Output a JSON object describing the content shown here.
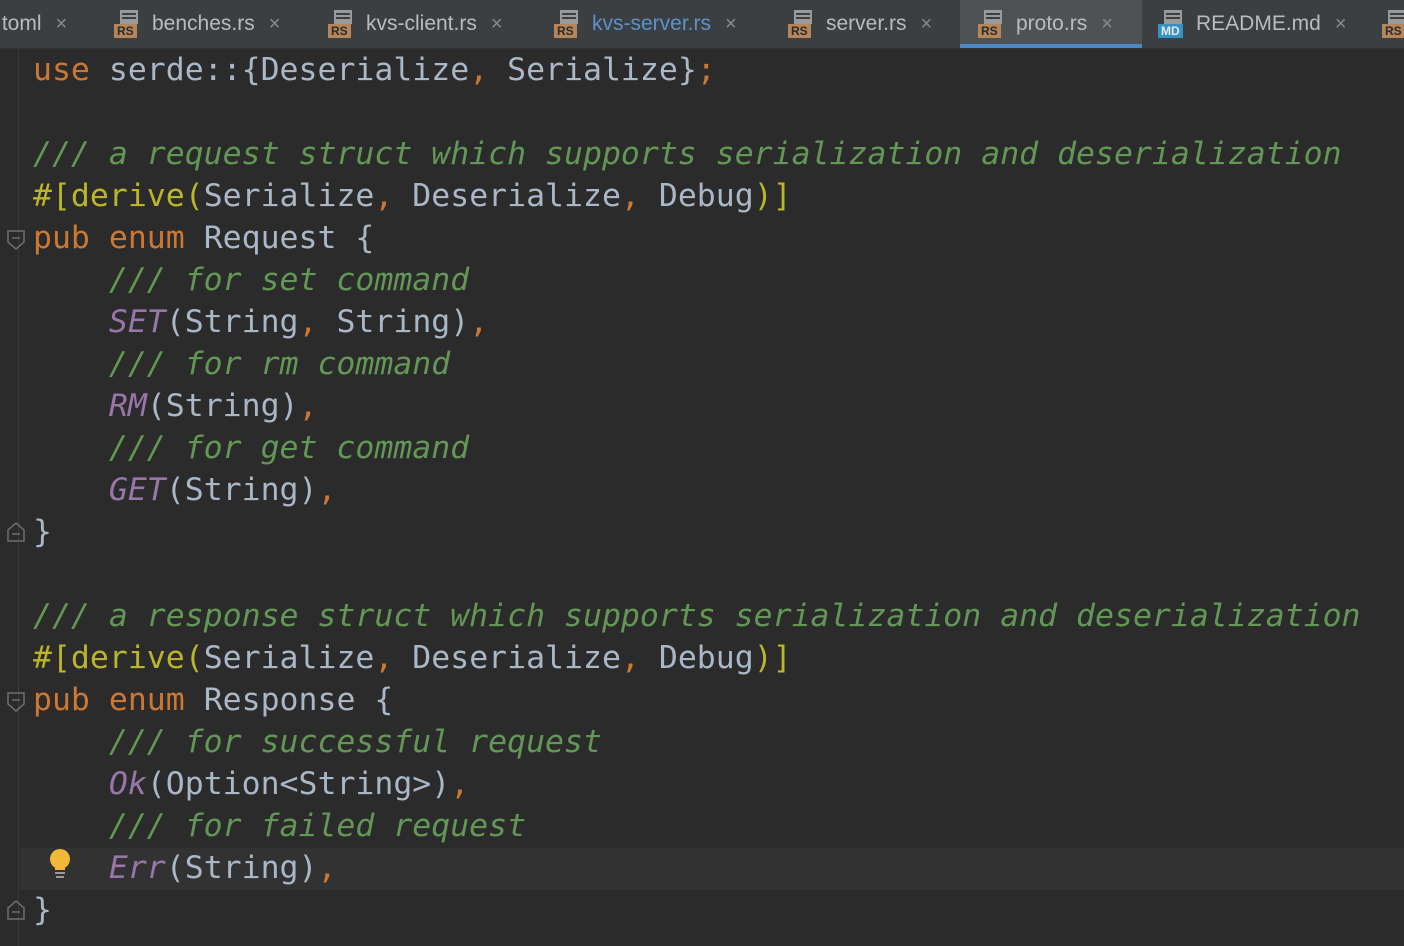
{
  "tabs": [
    {
      "name": ".toml",
      "icon": "toml-file-icon",
      "active": false,
      "modified": false
    },
    {
      "name": "benches.rs",
      "icon": "rust-file-icon",
      "badge": "RS",
      "active": false
    },
    {
      "name": "kvs-client.rs",
      "icon": "rust-file-icon",
      "badge": "RS",
      "active": false
    },
    {
      "name": "kvs-server.rs",
      "icon": "rust-file-icon",
      "badge": "RS",
      "active": false,
      "highlight_color": "#5c92c9"
    },
    {
      "name": "server.rs",
      "icon": "rust-file-icon",
      "badge": "RS",
      "active": false
    },
    {
      "name": "proto.rs",
      "icon": "rust-file-icon",
      "badge": "RS",
      "active": true
    },
    {
      "name": "README.md",
      "icon": "markdown-file-icon",
      "badge": "MD",
      "active": false
    },
    {
      "name": "",
      "icon": "rust-file-icon",
      "badge": "RS",
      "active": false
    }
  ],
  "close_glyph": "×",
  "editor": {
    "lines": [
      "use serde::{Deserialize, Serialize};",
      "",
      "/// a request struct which supports serialization and deserialization",
      "#[derive(Serialize, Deserialize, Debug)]",
      "pub enum Request {",
      "    /// for set command",
      "    SET(String, String),",
      "    /// for rm command",
      "    RM(String),",
      "    /// for get command",
      "    GET(String),",
      "}",
      "",
      "/// a response struct which supports serialization and deserialization",
      "#[derive(Serialize, Deserialize, Debug)]",
      "pub enum Response {",
      "    /// for successful request",
      "    Ok(Option<String>),",
      "    /// for failed request",
      "    Err(String),",
      "}"
    ],
    "caret_line": 20,
    "intention_icon": "lightbulb-icon"
  },
  "colors": {
    "background": "#2b2b2b",
    "keyword": "#cc7832",
    "comment": "#629755",
    "attribute": "#bbb529",
    "enum_variant": "#9876aa",
    "text": "#a9b7c6",
    "active_tab_underline": "#4a88c7"
  }
}
